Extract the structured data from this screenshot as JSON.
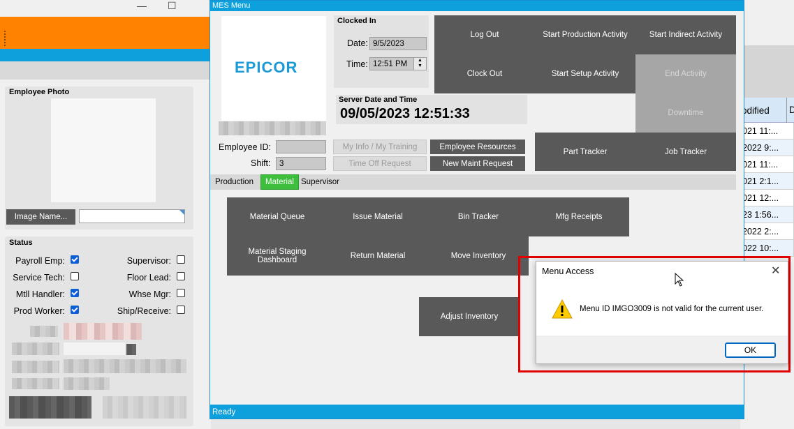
{
  "left_window": {
    "employee_photo_label": "Employee Photo",
    "image_name_button": "Image Name...",
    "status_label": "Status",
    "checkboxes": [
      {
        "label": "Payroll Emp:",
        "checked": true
      },
      {
        "label": "Service Tech:",
        "checked": false
      },
      {
        "label": "Mtll Handler:",
        "checked": true
      },
      {
        "label": "Prod Worker:",
        "checked": true
      },
      {
        "label": "Supervisor:",
        "checked": false
      },
      {
        "label": "Floor Lead:",
        "checked": false
      },
      {
        "label": "Whse Mgr:",
        "checked": false
      },
      {
        "label": "Ship/Receive:",
        "checked": false
      }
    ],
    "minimize_glyph": "—",
    "maximize_glyph": "☐"
  },
  "right_grid": {
    "header": "odified",
    "header2": "D",
    "rows": [
      "021 11:...",
      "2022 9:...",
      "021 11:...",
      "021 2:1...",
      "021 12:...",
      "23 1:56...",
      "2022 2:...",
      "022 10:..."
    ]
  },
  "mes": {
    "title": "MES Menu",
    "logo": "EPICOR",
    "clocked_in_label": "Clocked In",
    "date_label": "Date:",
    "date_value": "9/5/2023",
    "time_label": "Time:",
    "time_value": "12:51 PM",
    "server_label": "Server Date and Time",
    "server_value": "09/05/2023 12:51:33",
    "employee_id_label": "Employee ID:",
    "shift_label": "Shift:",
    "shift_value": "3",
    "buttons": {
      "log_out": "Log Out",
      "start_production": "Start Production Activity",
      "start_indirect": "Start Indirect Activity",
      "clock_out": "Clock Out",
      "start_setup": "Start Setup Activity",
      "end_activity": "End Activity",
      "downtime": "Downtime",
      "my_info": "My Info / My Training",
      "employee_resources": "Employee Resources",
      "time_off": "Time Off Request",
      "new_maint": "New Maint Request",
      "part_tracker": "Part Tracker",
      "job_tracker": "Job Tracker"
    },
    "tabs": [
      {
        "label": "Production",
        "active": false
      },
      {
        "label": "Material",
        "active": true
      },
      {
        "label": "Supervisor",
        "active": false
      }
    ],
    "material_buttons": {
      "queue": "Material Queue",
      "issue": "Issue Material",
      "bin_tracker": "Bin Tracker",
      "mfg_receipts": "Mfg Receipts",
      "staging": "Material Staging Dashboard",
      "return": "Return Material",
      "move": "Move Inventory",
      "adjust": "Adjust Inventory"
    },
    "status_text": "Ready"
  },
  "dialog": {
    "title": "Menu Access",
    "message": "Menu ID IMGO3009 is not valid for the current user.",
    "ok": "OK"
  },
  "colors": {
    "accent_blue": "#0ea0dc",
    "orange": "#ff8200",
    "dark_button": "#595959",
    "tab_green": "#3dbf3d",
    "highlight_red": "#e00000"
  }
}
